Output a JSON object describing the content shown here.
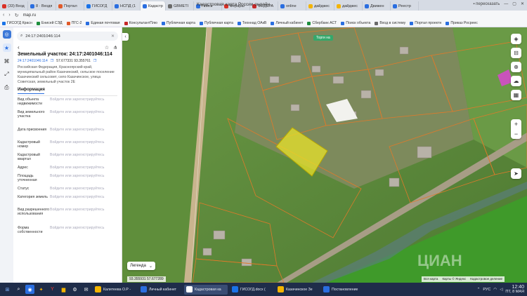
{
  "browser": {
    "window_title": "Кадастровая карта России онлайн",
    "tabs": [
      {
        "label": "(33) Вход",
        "color": "#d93025"
      },
      {
        "label": "8 · Входя",
        "color": "#2a6ee0"
      },
      {
        "label": "Портал",
        "color": "#e05a2a"
      },
      {
        "label": "ГИСОГД",
        "color": "#1a73e8"
      },
      {
        "label": "НСПД (1",
        "color": "#2a6ee0"
      },
      {
        "label": "Кадастр",
        "color": "#2a6ee0",
        "active": true
      },
      {
        "label": "GBMETI",
        "color": "#6a6a6a"
      },
      {
        "label": "Поиск",
        "color": "#2a6ee0"
      },
      {
        "label": "Ферарш",
        "color": "#d93025"
      },
      {
        "label": "ФЕДЕРА",
        "color": "#c62828"
      },
      {
        "label": "online",
        "color": "#2a6ee0"
      },
      {
        "label": "дайджес",
        "color": "#f4b400"
      },
      {
        "label": "дайджес",
        "color": "#f4b400"
      },
      {
        "label": "Движен",
        "color": "#2a6ee0"
      },
      {
        "label": "Реестр",
        "color": "#2a6ee0"
      }
    ],
    "url": "map.ru",
    "retell_label": "пересказать",
    "bookmarks": [
      {
        "label": "ГИСОГД Красн",
        "color": "#1a73e8"
      },
      {
        "label": "Енисей СЭД",
        "color": "#1e8e3e"
      },
      {
        "label": "ПГС-2",
        "color": "#e05a2a"
      },
      {
        "label": "Единая почтовая",
        "color": "#2a6ee0"
      },
      {
        "label": "КонсультантПлю",
        "color": "#c62828"
      },
      {
        "label": "Публичная карта",
        "color": "#2a6ee0"
      },
      {
        "label": "Публичная карта",
        "color": "#2a6ee0"
      },
      {
        "label": "Техннад ОАкВ",
        "color": "#2a6ee0"
      },
      {
        "label": "Личный кабинет",
        "color": "#2a6ee0"
      },
      {
        "label": "Сбербанк АСТ",
        "color": "#1e8e3e"
      },
      {
        "label": "Поиск объекта",
        "color": "#2a6ee0"
      },
      {
        "label": "Вход в систему",
        "color": "#6a6a6a"
      },
      {
        "label": "Портал проектн",
        "color": "#2a6ee0"
      },
      {
        "label": "Приказ Росреес",
        "color": "#2a6ee0"
      }
    ]
  },
  "search": {
    "value": "24:17:2401046:114"
  },
  "parcel": {
    "title": "Земельный участок: 24:17:2401046:114",
    "cad_number": "24:17:2401046:114",
    "coordinates": "57.677331 93.355761",
    "address": "Российская Федерация, Красноярский край, муниципальный район Казачинский, сельское поселение Казачинский сельсовет, село Казачинское, улица Советская, земельный участок 2Е"
  },
  "info": {
    "section_label": "Информация",
    "placeholder": "Войдите или зарегистрируйтесь",
    "rows": [
      {
        "key": "Вид объекта недвижимости"
      },
      {
        "key": "Вид земельного участка"
      },
      {
        "key": "Дата присвоения"
      },
      {
        "key": "Кадастровый номер"
      },
      {
        "key": "Кадастровый квартал"
      },
      {
        "key": "Адрес"
      },
      {
        "key": "Площадь уточненная"
      },
      {
        "key": "Статус"
      },
      {
        "key": "Категория земель"
      },
      {
        "key": "Вид разрешенного использования"
      },
      {
        "key": "Форма собственности"
      }
    ]
  },
  "map": {
    "label_top": "Торги на",
    "legend_label": "Легенда",
    "coords_readout": "93.355931 57.677289",
    "scale_text": [
      "Вся карта",
      "Карты © Яндекс",
      "Кадастровое деление"
    ],
    "watermark": "ЦИАН"
  },
  "taskbar": {
    "apps": [
      {
        "label": "Калитеева О.Р -",
        "color": "#f4b400"
      },
      {
        "label": "Личный кабинет",
        "color": "#2a6ee0"
      },
      {
        "label": "Кадастровая ка",
        "color": "#ffffff",
        "active": true
      },
      {
        "label": "ГИСОГД.docx (",
        "color": "#1a73e8"
      },
      {
        "label": "Казачинское Зе",
        "color": "#f4b400"
      },
      {
        "label": "Постановление",
        "color": "#2a6ee0"
      }
    ],
    "lang": "РУС",
    "time": "12:40",
    "date": "ПТ, 8 МАЯ"
  }
}
